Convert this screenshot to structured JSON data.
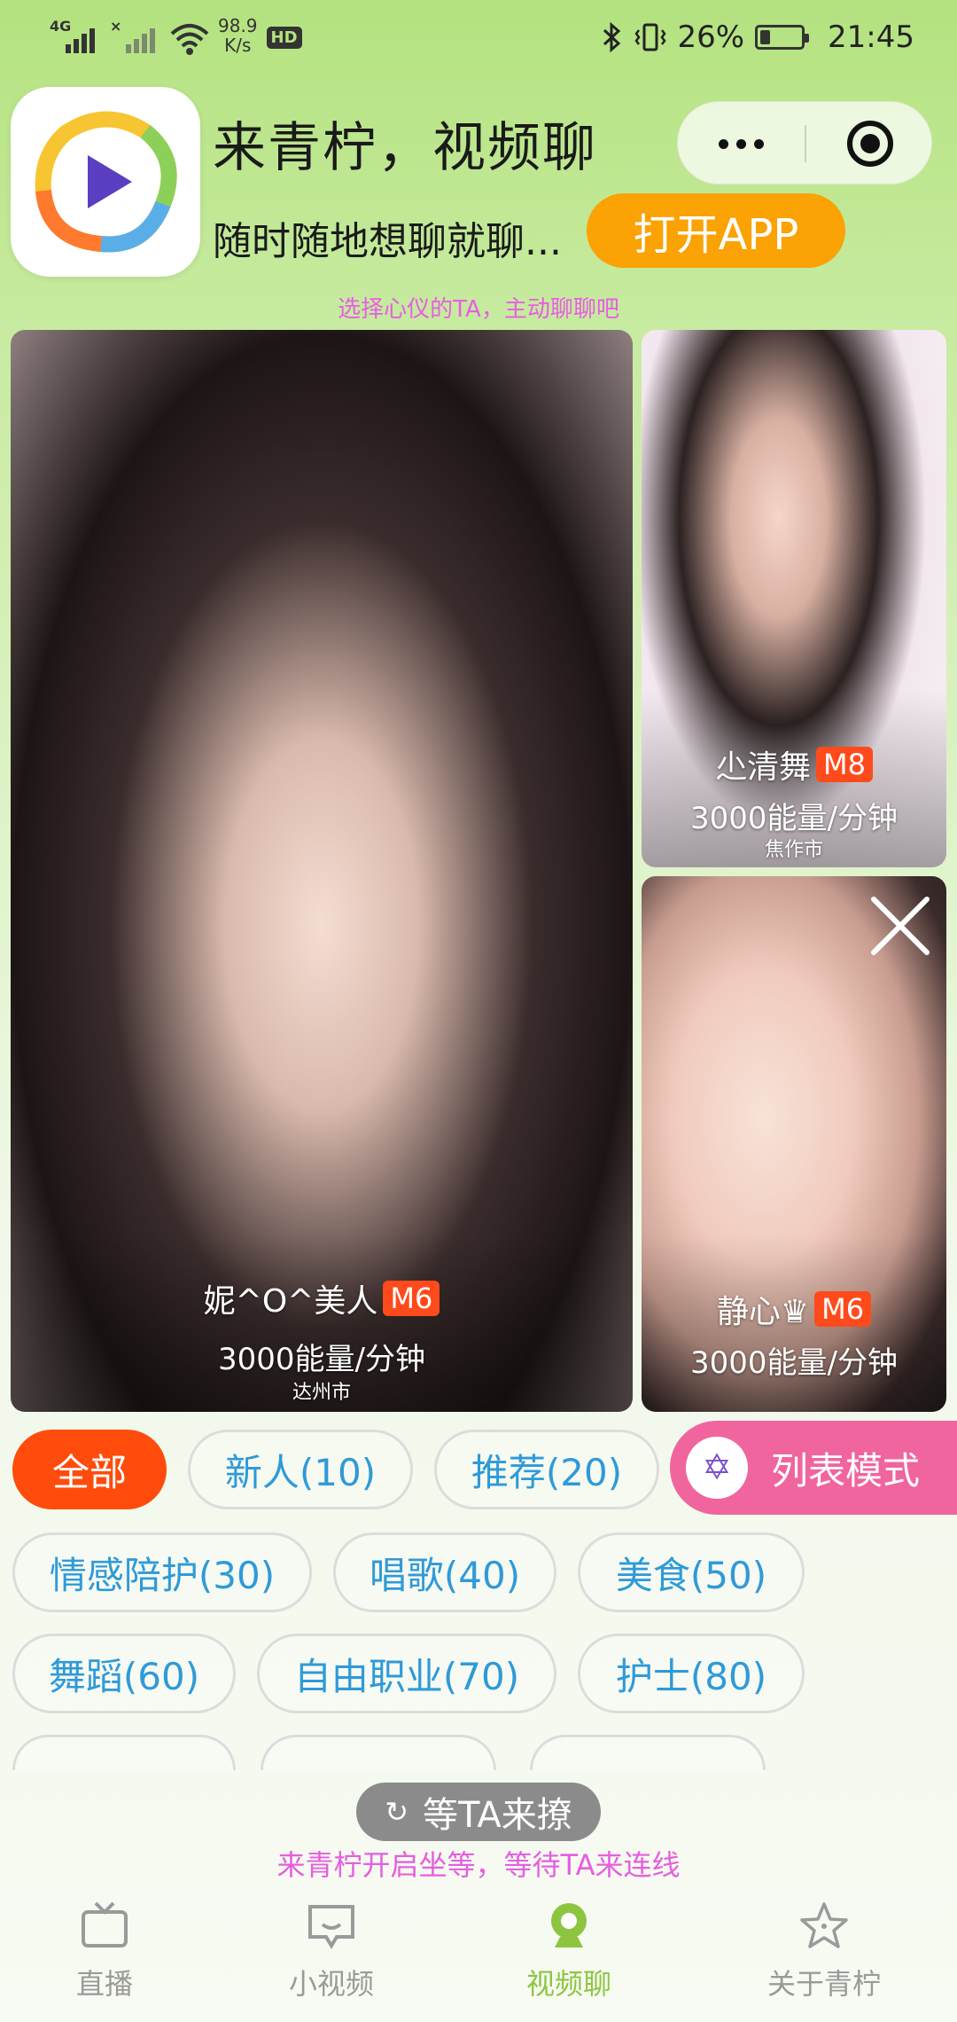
{
  "status_bar": {
    "network_tag": "4G",
    "speed_value": "98.9",
    "speed_unit": "K/s",
    "hd": "HD",
    "battery_percent": "26%",
    "battery_level": 0.26,
    "time": "21:45"
  },
  "header": {
    "title": "来青柠，视频聊",
    "subtitle": "随时随地想聊就聊...",
    "open_app_label": "打开APP",
    "hint": "选择心仪的TA，主动聊聊吧"
  },
  "cards": [
    {
      "name": "妮^O^美人",
      "level": "M6",
      "price": "3000能量/分钟",
      "city": "达州市"
    },
    {
      "name": "尐清舞",
      "level": "M8",
      "price": "3000能量/分钟",
      "city": "焦作市"
    },
    {
      "name": "静心♛",
      "level": "M6",
      "price": "3000能量/分钟",
      "city": ""
    }
  ],
  "categories": {
    "row1": [
      "全部",
      "新人(10)",
      "推荐(20)"
    ],
    "row2": [
      "情感陪护(30)",
      "唱歌(40)",
      "美食(50)"
    ],
    "row3": [
      "舞蹈(60)",
      "自由职业(70)",
      "护士(80)"
    ]
  },
  "list_mode_label": "列表模式",
  "wait": {
    "button_label": "等TA来撩",
    "subtitle": "来青柠开启坐等，等待TA来连线"
  },
  "tabs": [
    {
      "label": "直播",
      "icon": "tv-icon"
    },
    {
      "label": "小视频",
      "icon": "chat-screen-icon"
    },
    {
      "label": "视频聊",
      "icon": "webcam-icon"
    },
    {
      "label": "关于青柠",
      "icon": "star-icon"
    }
  ],
  "colors": {
    "accent_orange": "#fba204",
    "active_category": "#ff4c0c",
    "list_mode_pink": "#f0659e",
    "hint_pink": "#e85ee4",
    "category_text": "#2f9ad8",
    "active_tab": "#8dc540"
  }
}
